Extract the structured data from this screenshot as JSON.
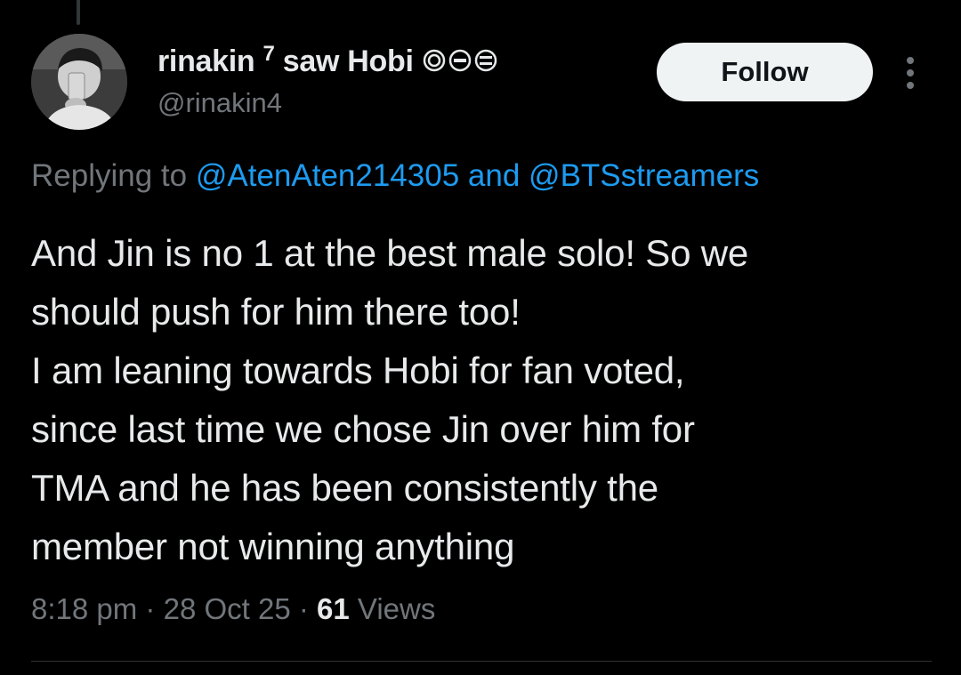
{
  "author": {
    "display_name": "rinakin",
    "superscript": "7",
    "name_suffix": "saw Hobi",
    "name_emoji": [
      "purple-circle-emoji",
      "purple-circle-emoji",
      "purple-circle-emoji"
    ],
    "handle": "@rinakin4"
  },
  "follow_label": "Follow",
  "reply": {
    "prefix": "Replying to",
    "mention_1": "@AtenAten214305",
    "connector": "and",
    "mention_2": "@BTSstreamers"
  },
  "tweet": {
    "text": "And Jin is no 1 at the best male solo! So we\nshould push for him there too!\nI am leaning towards Hobi for fan voted,\nsince last time we chose Jin over him for\nTMA and he has been consistently the\nmember not winning anything"
  },
  "meta": {
    "time": "8:18 pm",
    "separator": "·",
    "date": "28 Oct 25",
    "views_count": "61",
    "views_label": "Views"
  },
  "colors": {
    "background": "#000000",
    "text_primary": "#e7e9ea",
    "text_secondary": "#71767b",
    "link": "#1d9bf0",
    "follow_button_bg": "#eff3f4"
  }
}
